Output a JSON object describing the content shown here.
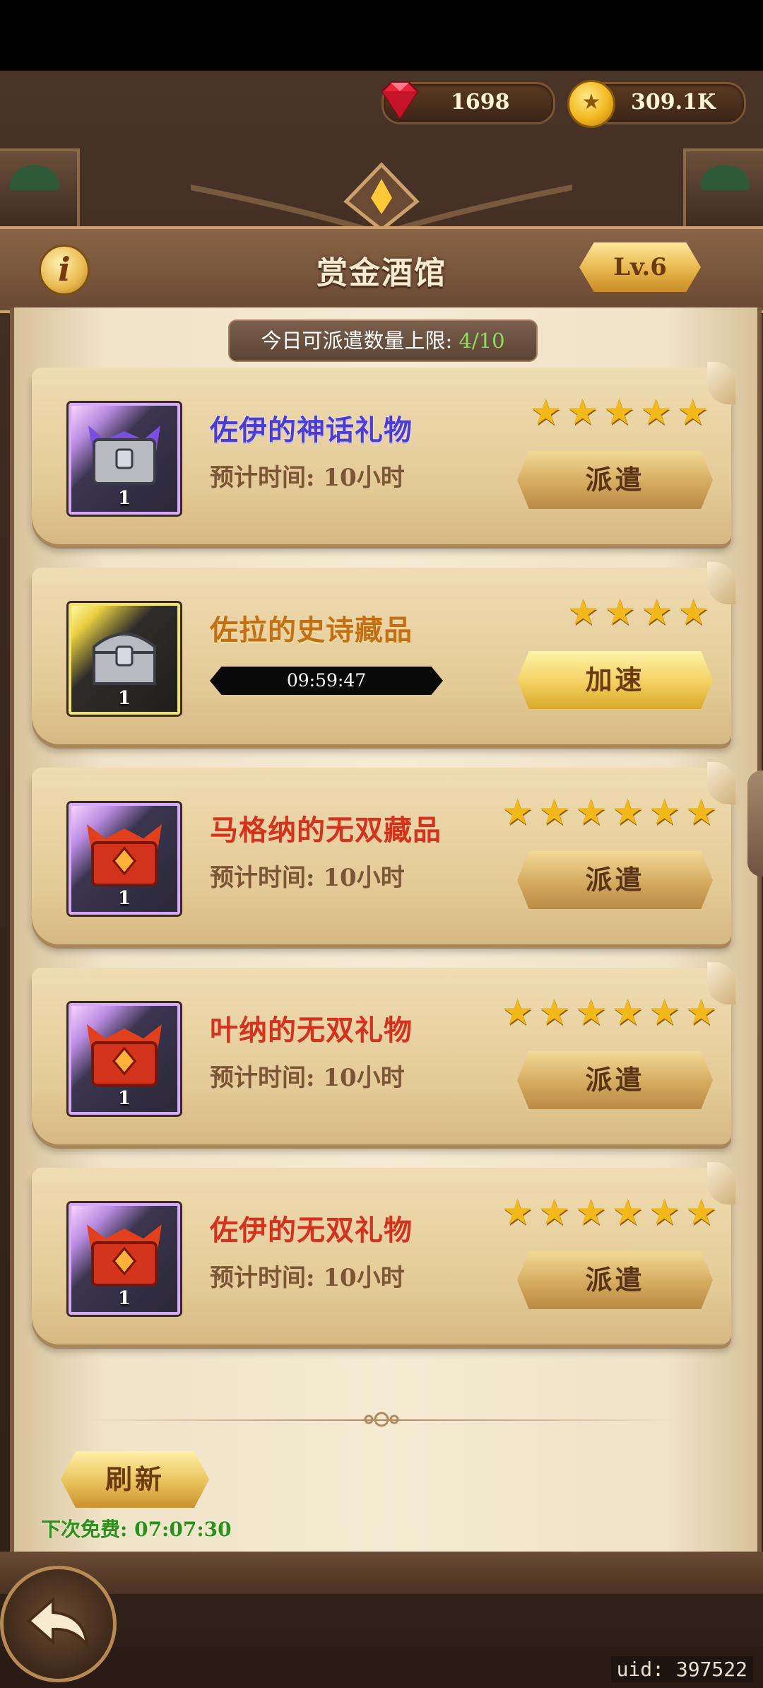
{
  "currency": {
    "gems": "1698",
    "gold": "309.1K"
  },
  "header": {
    "title": "赏金酒馆",
    "level": "Lv.6",
    "info_icon": "info-icon"
  },
  "limit": {
    "label": "今日可派遣数量上限: ",
    "value": "4/10"
  },
  "quests": [
    {
      "name": "佐伊的神话礼物",
      "stars": 5,
      "count": "1",
      "eta": "预计时间: 10小时",
      "action": "派遣",
      "state": "idle",
      "rarity": "mythic"
    },
    {
      "name": "佐拉的史诗藏品",
      "stars": 4,
      "count": "1",
      "timer": "09:59:47",
      "action": "加速",
      "state": "running",
      "rarity": "epic"
    },
    {
      "name": "马格纳的无双藏品",
      "stars": 6,
      "count": "1",
      "eta": "预计时间: 10小时",
      "action": "派遣",
      "state": "idle",
      "rarity": "legendary"
    },
    {
      "name": "叶纳的无双礼物",
      "stars": 6,
      "count": "1",
      "eta": "预计时间: 10小时",
      "action": "派遣",
      "state": "idle",
      "rarity": "legendary"
    },
    {
      "name": "佐伊的无双礼物",
      "stars": 6,
      "count": "1",
      "eta": "预计时间: 10小时",
      "action": "派遣",
      "state": "idle",
      "rarity": "legendary"
    }
  ],
  "footer": {
    "refresh_label": "刷新",
    "free_next": "下次免费: 07:07:30",
    "uid": "uid: 397522"
  },
  "colors": {
    "accent_gold": "#e9b94c",
    "green_text": "#2e8f1e",
    "name_red": "#d3321d",
    "name_purple": "#4d3bd6"
  }
}
